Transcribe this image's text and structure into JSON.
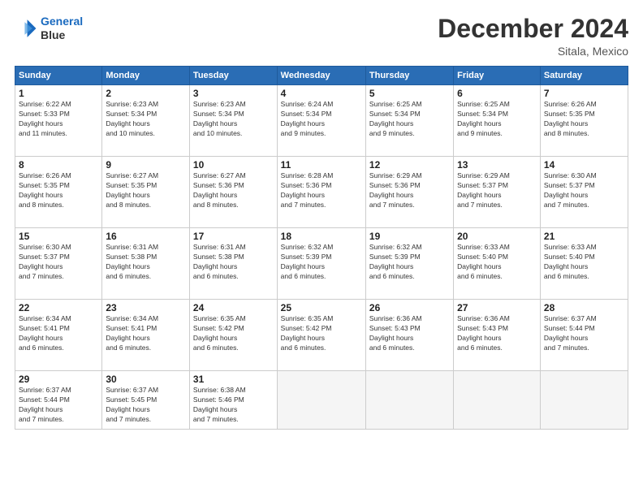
{
  "logo": {
    "line1": "General",
    "line2": "Blue"
  },
  "title": "December 2024",
  "location": "Sitala, Mexico",
  "days_header": [
    "Sunday",
    "Monday",
    "Tuesday",
    "Wednesday",
    "Thursday",
    "Friday",
    "Saturday"
  ],
  "weeks": [
    [
      {
        "day": "1",
        "sunrise": "6:22 AM",
        "sunset": "5:33 PM",
        "daylight": "11 hours and 11 minutes."
      },
      {
        "day": "2",
        "sunrise": "6:23 AM",
        "sunset": "5:34 PM",
        "daylight": "11 hours and 10 minutes."
      },
      {
        "day": "3",
        "sunrise": "6:23 AM",
        "sunset": "5:34 PM",
        "daylight": "11 hours and 10 minutes."
      },
      {
        "day": "4",
        "sunrise": "6:24 AM",
        "sunset": "5:34 PM",
        "daylight": "11 hours and 9 minutes."
      },
      {
        "day": "5",
        "sunrise": "6:25 AM",
        "sunset": "5:34 PM",
        "daylight": "11 hours and 9 minutes."
      },
      {
        "day": "6",
        "sunrise": "6:25 AM",
        "sunset": "5:34 PM",
        "daylight": "11 hours and 9 minutes."
      },
      {
        "day": "7",
        "sunrise": "6:26 AM",
        "sunset": "5:35 PM",
        "daylight": "11 hours and 8 minutes."
      }
    ],
    [
      {
        "day": "8",
        "sunrise": "6:26 AM",
        "sunset": "5:35 PM",
        "daylight": "11 hours and 8 minutes."
      },
      {
        "day": "9",
        "sunrise": "6:27 AM",
        "sunset": "5:35 PM",
        "daylight": "11 hours and 8 minutes."
      },
      {
        "day": "10",
        "sunrise": "6:27 AM",
        "sunset": "5:36 PM",
        "daylight": "11 hours and 8 minutes."
      },
      {
        "day": "11",
        "sunrise": "6:28 AM",
        "sunset": "5:36 PM",
        "daylight": "11 hours and 7 minutes."
      },
      {
        "day": "12",
        "sunrise": "6:29 AM",
        "sunset": "5:36 PM",
        "daylight": "11 hours and 7 minutes."
      },
      {
        "day": "13",
        "sunrise": "6:29 AM",
        "sunset": "5:37 PM",
        "daylight": "11 hours and 7 minutes."
      },
      {
        "day": "14",
        "sunrise": "6:30 AM",
        "sunset": "5:37 PM",
        "daylight": "11 hours and 7 minutes."
      }
    ],
    [
      {
        "day": "15",
        "sunrise": "6:30 AM",
        "sunset": "5:37 PM",
        "daylight": "11 hours and 7 minutes."
      },
      {
        "day": "16",
        "sunrise": "6:31 AM",
        "sunset": "5:38 PM",
        "daylight": "11 hours and 6 minutes."
      },
      {
        "day": "17",
        "sunrise": "6:31 AM",
        "sunset": "5:38 PM",
        "daylight": "11 hours and 6 minutes."
      },
      {
        "day": "18",
        "sunrise": "6:32 AM",
        "sunset": "5:39 PM",
        "daylight": "11 hours and 6 minutes."
      },
      {
        "day": "19",
        "sunrise": "6:32 AM",
        "sunset": "5:39 PM",
        "daylight": "11 hours and 6 minutes."
      },
      {
        "day": "20",
        "sunrise": "6:33 AM",
        "sunset": "5:40 PM",
        "daylight": "11 hours and 6 minutes."
      },
      {
        "day": "21",
        "sunrise": "6:33 AM",
        "sunset": "5:40 PM",
        "daylight": "11 hours and 6 minutes."
      }
    ],
    [
      {
        "day": "22",
        "sunrise": "6:34 AM",
        "sunset": "5:41 PM",
        "daylight": "11 hours and 6 minutes."
      },
      {
        "day": "23",
        "sunrise": "6:34 AM",
        "sunset": "5:41 PM",
        "daylight": "11 hours and 6 minutes."
      },
      {
        "day": "24",
        "sunrise": "6:35 AM",
        "sunset": "5:42 PM",
        "daylight": "11 hours and 6 minutes."
      },
      {
        "day": "25",
        "sunrise": "6:35 AM",
        "sunset": "5:42 PM",
        "daylight": "11 hours and 6 minutes."
      },
      {
        "day": "26",
        "sunrise": "6:36 AM",
        "sunset": "5:43 PM",
        "daylight": "11 hours and 6 minutes."
      },
      {
        "day": "27",
        "sunrise": "6:36 AM",
        "sunset": "5:43 PM",
        "daylight": "11 hours and 6 minutes."
      },
      {
        "day": "28",
        "sunrise": "6:37 AM",
        "sunset": "5:44 PM",
        "daylight": "11 hours and 7 minutes."
      }
    ],
    [
      {
        "day": "29",
        "sunrise": "6:37 AM",
        "sunset": "5:44 PM",
        "daylight": "11 hours and 7 minutes."
      },
      {
        "day": "30",
        "sunrise": "6:37 AM",
        "sunset": "5:45 PM",
        "daylight": "11 hours and 7 minutes."
      },
      {
        "day": "31",
        "sunrise": "6:38 AM",
        "sunset": "5:46 PM",
        "daylight": "11 hours and 7 minutes."
      },
      null,
      null,
      null,
      null
    ]
  ]
}
